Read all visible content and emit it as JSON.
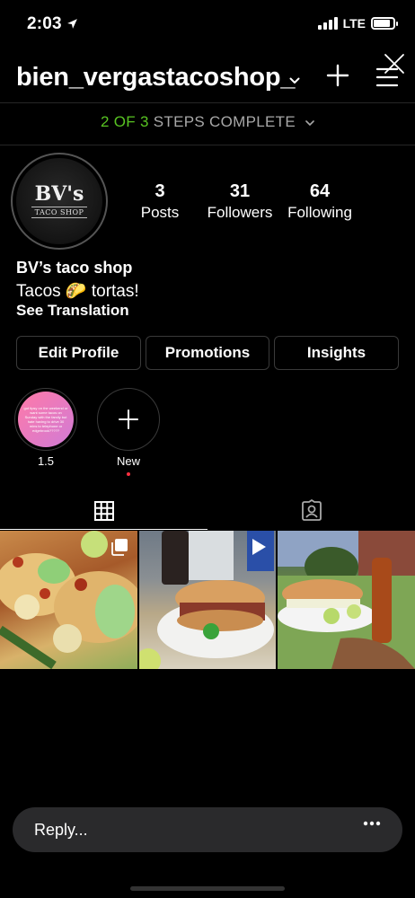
{
  "status_bar": {
    "time": "2:03",
    "network": "LTE",
    "battery_level": 0.85
  },
  "header": {
    "username": "bien_vergastacoshop_",
    "icons": [
      "chevron-down-icon",
      "plus-icon",
      "menu-icon",
      "close-icon"
    ]
  },
  "steps": {
    "done": "2 OF 3",
    "rest": "STEPS COMPLETE"
  },
  "profile": {
    "avatar_logo": "BV's",
    "avatar_sub": "TACO SHOP",
    "stats": [
      {
        "number": "3",
        "label": "Posts"
      },
      {
        "number": "31",
        "label": "Followers"
      },
      {
        "number": "64",
        "label": "Following"
      }
    ],
    "name": "BV’s taco shop",
    "bio": "Tacos 🌮 tortas!",
    "see_translation": "See Translation"
  },
  "buttons": {
    "edit_profile": "Edit Profile",
    "promotions": "Promotions",
    "insights": "Insights"
  },
  "highlights": [
    {
      "label": "1.5",
      "story_text": "got tipsy on the weekend or want some tacos on Sunday with the family but hate having to drive 30 mins to telephone or edgebrook?????"
    },
    {
      "label": "New"
    }
  ],
  "tabs": [
    "grid-icon",
    "tagged-icon"
  ],
  "posts": [
    {
      "type": "multi"
    },
    {
      "type": "video"
    },
    {
      "type": "photo"
    }
  ],
  "reply": {
    "placeholder": "Reply..."
  },
  "colors": {
    "background": "#000000",
    "steps_done": "#58c322",
    "steps_rest": "#a8a8a8",
    "button_border": "#3a3a3a",
    "notification_dot": "#ff3040"
  }
}
